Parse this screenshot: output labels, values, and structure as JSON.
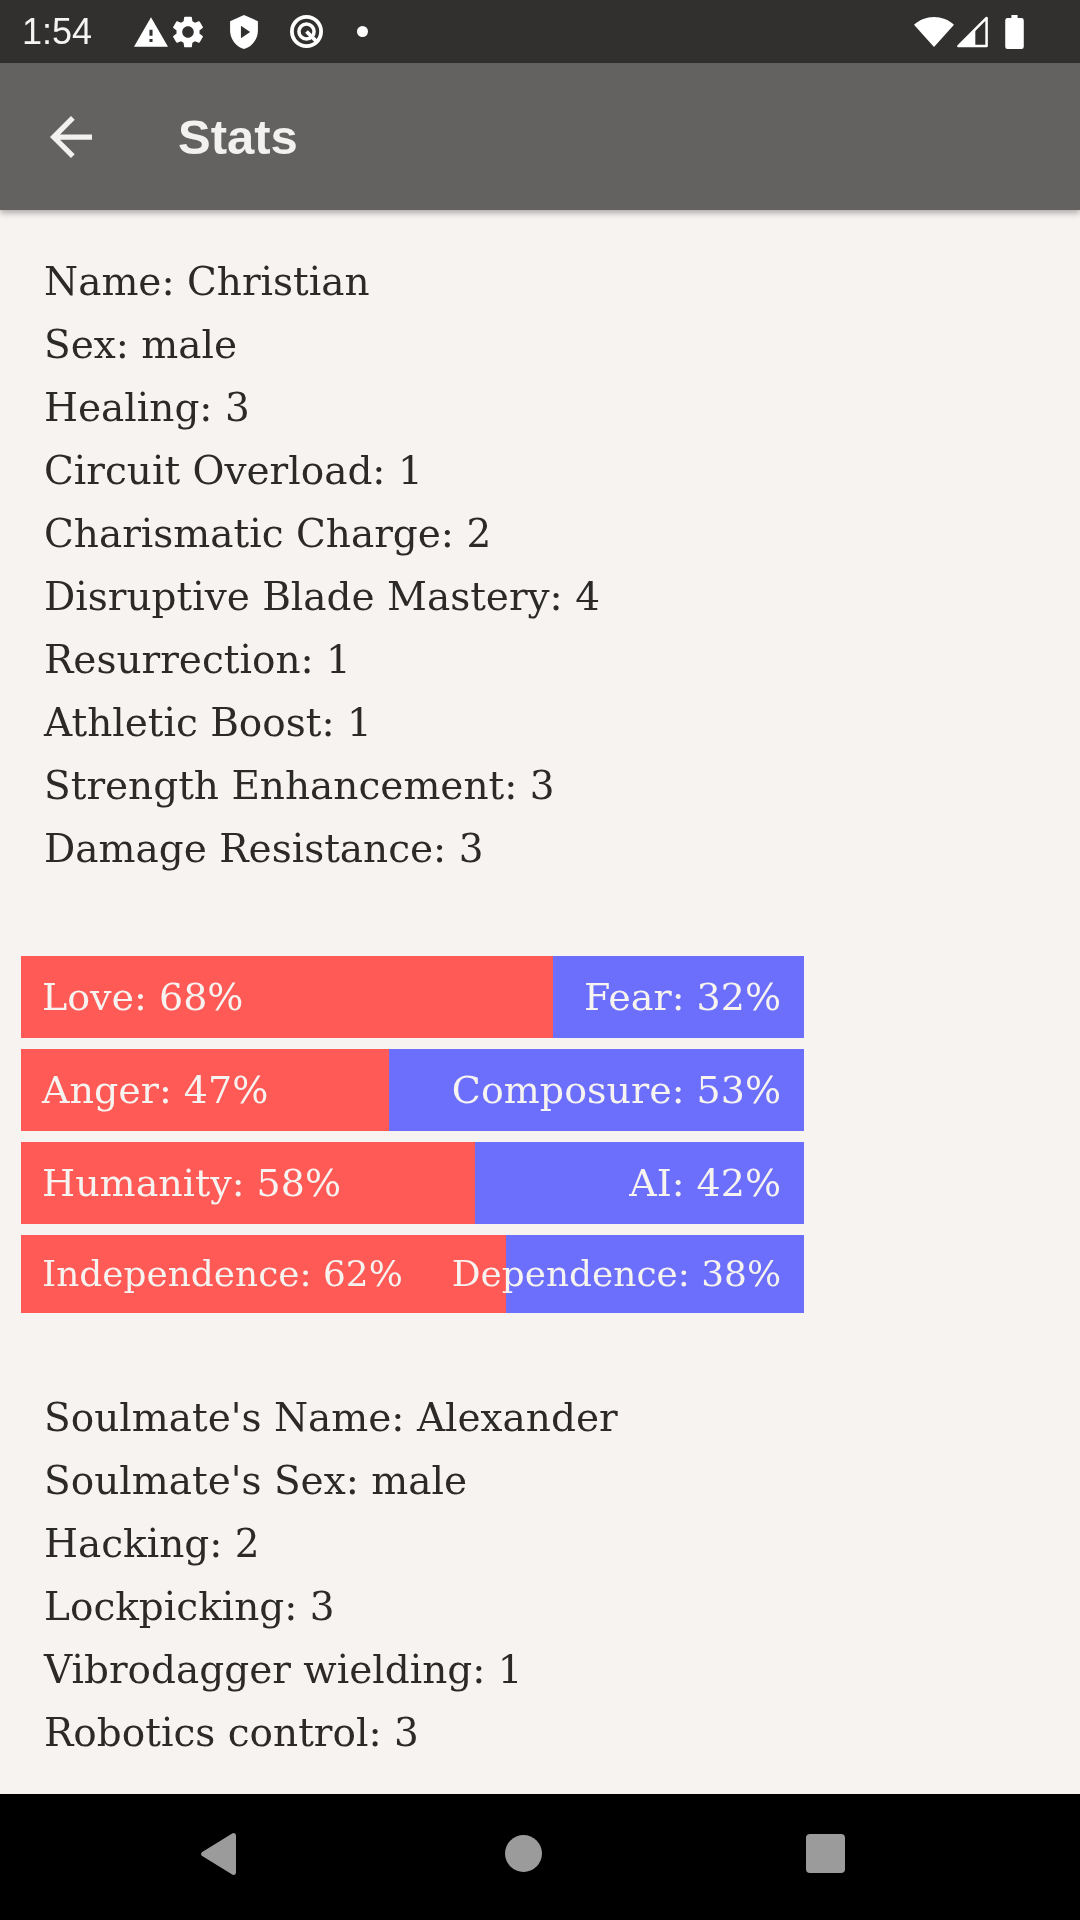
{
  "status_bar": {
    "time": "1:54"
  },
  "app_bar": {
    "title": "Stats"
  },
  "profile_stats": [
    "Name: Christian",
    "Sex: male",
    "Healing: 3",
    "Circuit Overload: 1",
    "Charismatic Charge: 2",
    "Disruptive Blade Mastery: 4",
    "Resurrection: 1",
    "Athletic Boost: 1",
    "Strength Enhancement: 3",
    "Damage Resistance: 3"
  ],
  "ratio_bars": [
    {
      "left_label": "Love: 68%",
      "right_label": "Fear: 32%",
      "level": 0.68
    },
    {
      "left_label": "Anger: 47%",
      "right_label": "Composure: 53%",
      "level": 0.47
    },
    {
      "left_label": "Humanity: 58%",
      "right_label": "AI: 42%",
      "level": 0.58
    },
    {
      "left_label": "Independence: 62%",
      "right_label": "Dependence: 38%",
      "level": 0.62
    }
  ],
  "soulmate_stats": [
    "Soulmate's Name: Alexander",
    "Soulmate's Sex: male",
    "Hacking: 2",
    "Lockpicking: 3",
    "Vibrodagger wielding: 1",
    "Robotics control: 3"
  ]
}
